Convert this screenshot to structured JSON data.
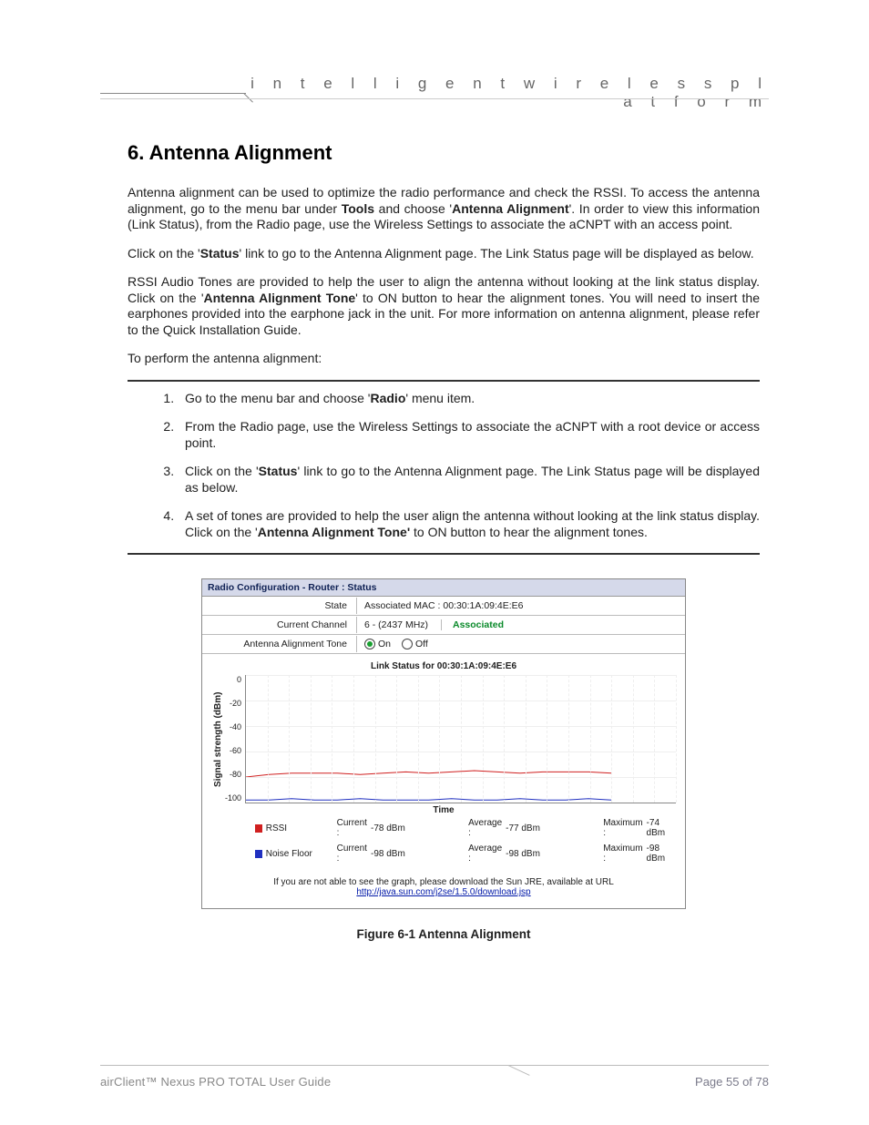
{
  "header": {
    "tagline": "i n t e l l i g e n t   w i r e l e s s   p l a t f o r m"
  },
  "heading": "6. Antenna Alignment",
  "para1": {
    "a": "Antenna alignment can be used to optimize the radio performance and check the RSSI. To access the antenna alignment, go to the menu bar under ",
    "b": "Tools",
    "c": " and choose '",
    "d": "Antenna Alignment",
    "e": "'. In order to view this information (Link Status), from the Radio page, use the Wireless Settings to associate the aCNPT with an access point."
  },
  "para2": {
    "a": "Click on the '",
    "b": "Status",
    "c": "' link to go to the Antenna Alignment page. The Link Status page will be displayed as below."
  },
  "para3": {
    "a": "RSSI Audio Tones are provided to help the user to align the antenna without looking at the link status display. Click on the '",
    "b": "Antenna Alignment Tone",
    "c": "' to ON button to hear the alignment tones. You will need to insert the earphones provided into the earphone jack in the unit. For more information on antenna alignment, please refer to the Quick Installation Guide."
  },
  "para4": "To perform the antenna alignment:",
  "steps": {
    "s1": {
      "a": "Go to the menu bar and choose '",
      "b": "Radio",
      "c": "' menu item."
    },
    "s2": "From the Radio page, use the Wireless Settings to associate the aCNPT with a root device or access point.",
    "s3": {
      "a": "Click on the '",
      "b": "Status",
      "c": "' link to go to the Antenna Alignment page. The Link Status page will be displayed as below."
    },
    "s4": {
      "a": "A set of tones are provided to help the user align the antenna without looking at the link status display. Click on the '",
      "b": "Antenna Alignment Tone'",
      "c": " to ON button to hear the alignment tones."
    }
  },
  "figure": {
    "title": "Radio Configuration - Router : Status",
    "state_label": "State",
    "state_value": "Associated MAC : 00:30:1A:09:4E:E6",
    "channel_label": "Current Channel",
    "channel_value": "6 - (2437 MHz)",
    "associated": "Associated",
    "tone_label": "Antenna Alignment Tone",
    "tone_on": "On",
    "tone_off": "Off",
    "chart_title": "Link Status for 00:30:1A:09:4E:E6",
    "ylabel": "Signal strength (dBm)",
    "xlabel": "Time",
    "legend": {
      "rssi": "RSSI",
      "noise": "Noise Floor",
      "cur_lbl": "Current :",
      "avg_lbl": "Average :",
      "max_lbl": "Maximum :",
      "rssi_cur": "-78 dBm",
      "rssi_avg": "-77 dBm",
      "rssi_max": "-74 dBm",
      "noise_cur": "-98 dBm",
      "noise_avg": "-98 dBm",
      "noise_max": "-98 dBm"
    },
    "note": "If you are not able to see the graph, please download the Sun JRE, available at URL",
    "note_url": "http://java.sun.com/j2se/1.5.0/download.jsp"
  },
  "chart_data": {
    "type": "line",
    "title": "Link Status for 00:30:1A:09:4E:E6",
    "xlabel": "Time",
    "ylabel": "Signal strength (dBm)",
    "ylim": [
      -100,
      0
    ],
    "yticks": [
      "0",
      "-20",
      "-40",
      "-60",
      "-80",
      "-100"
    ],
    "series": [
      {
        "name": "RSSI",
        "color": "#d02020",
        "values": [
          -80,
          -78,
          -77,
          -77,
          -77,
          -78,
          -77,
          -76,
          -77,
          -76,
          -75,
          -76,
          -77,
          -76,
          -76,
          -76,
          -77
        ]
      },
      {
        "name": "Noise Floor",
        "color": "#2030c0",
        "values": [
          -98,
          -98,
          -97,
          -98,
          -98,
          -97,
          -98,
          -98,
          -98,
          -97,
          -98,
          -98,
          -97,
          -98,
          -98,
          -97,
          -98
        ]
      }
    ]
  },
  "figcaption": "Figure 6-1 Antenna Alignment",
  "footer": {
    "guide": "airClient™ Nexus PRO TOTAL User Guide",
    "page": "Page 55 of 78"
  }
}
